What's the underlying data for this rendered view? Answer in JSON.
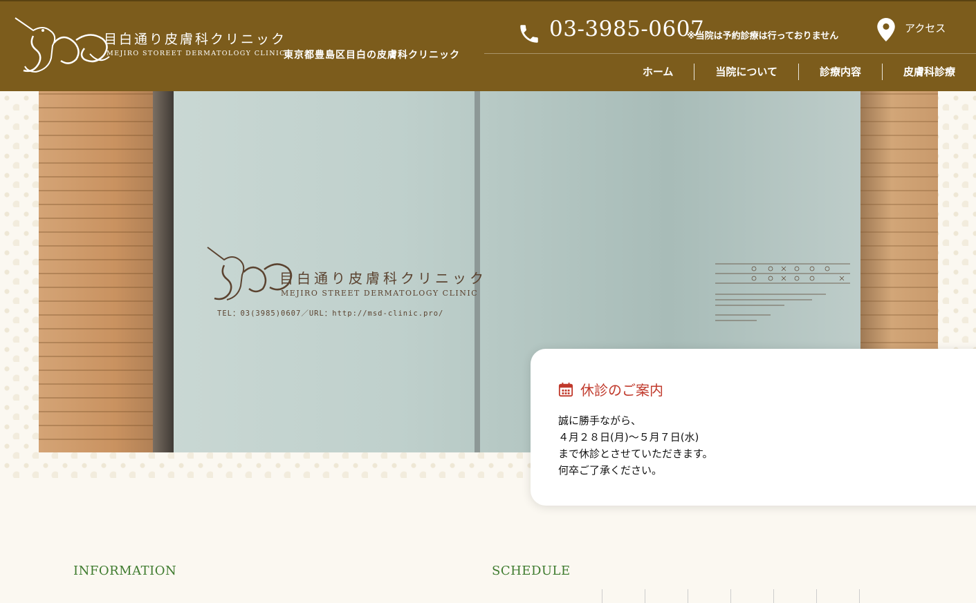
{
  "header": {
    "logo_text_jp": "目白通り皮膚科クリニック",
    "logo_text_en": "MEJIRO STOREET DERMATOLOGY CLINIC",
    "tagline": "東京都豊島区目白の皮膚科クリニック",
    "phone_number": "03-3985-0607",
    "phone_note": "※当院は予約診療は行っておりません",
    "access_label": "アクセス"
  },
  "nav": {
    "items": [
      {
        "label": "ホーム"
      },
      {
        "label": "当院について"
      },
      {
        "label": "診療内容"
      },
      {
        "label": "皮膚科診療"
      }
    ]
  },
  "hero": {
    "glass_logo_jp": "目白通り皮膚科クリニック",
    "glass_logo_en": "MEJIRO STREET DERMATOLOGY CLINIC",
    "glass_contact": "TEL：03(3985)0607／URL：http://msd-clinic.pro/"
  },
  "notice": {
    "title": "休診のご案内",
    "lines": [
      "誠に勝手ながら、",
      "４月２８日(月)〜５月７日(水)",
      "まで休診とさせていただきます。",
      "何卒ご了承ください。"
    ]
  },
  "sections": {
    "information_title": "INFORMATION",
    "schedule_title": "SCHEDULE"
  },
  "colors": {
    "header_bg": "#7c5c1c",
    "notice_title": "#c0392b",
    "section_title": "#3e7b2e"
  },
  "icons": {
    "phone": "phone-icon",
    "access": "map-pin-icon",
    "calendar": "calendar-icon",
    "logo": "unicorn-logo-icon"
  }
}
